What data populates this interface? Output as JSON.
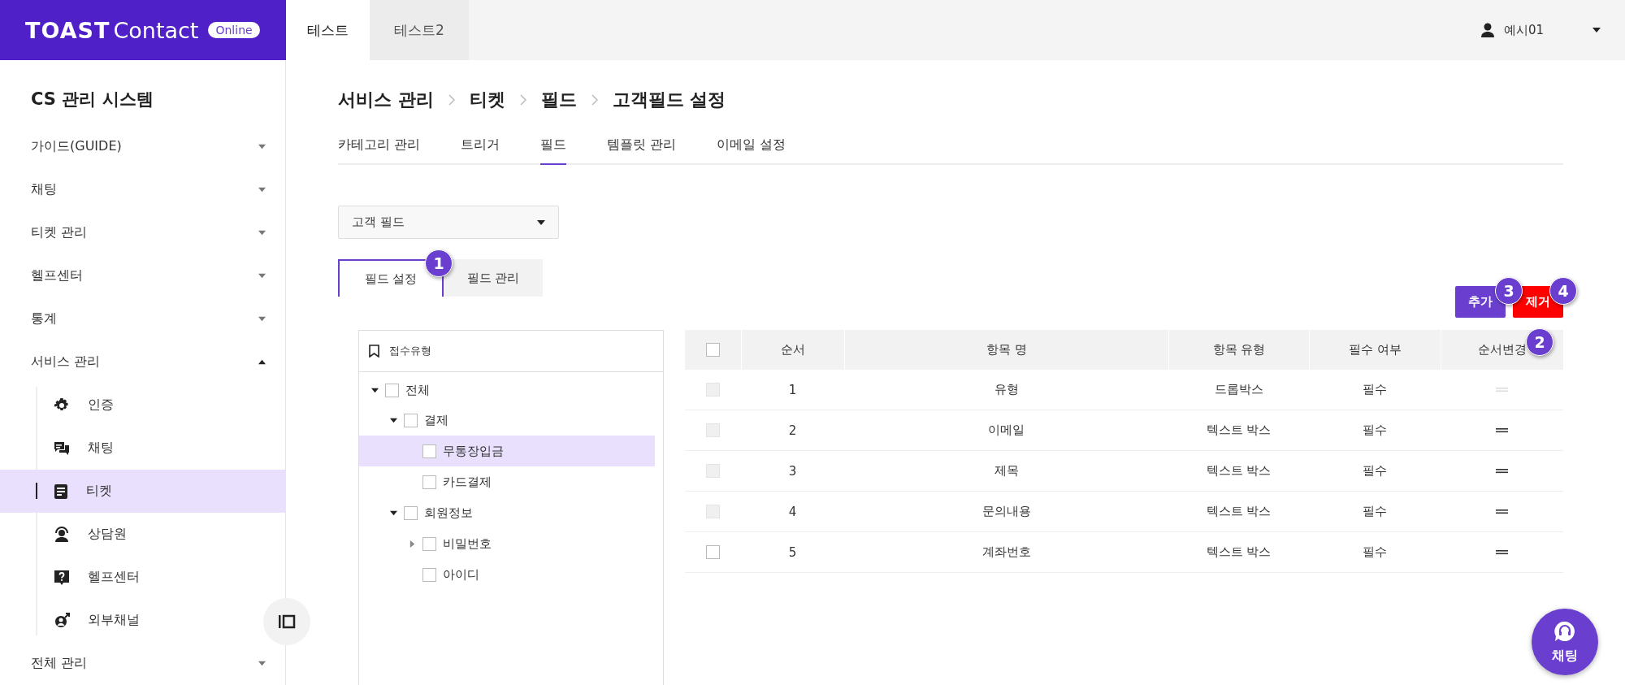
{
  "logo": {
    "brand": "TOAST",
    "product": "Contact",
    "badge": "Online"
  },
  "top_tabs": [
    {
      "label": "테스트",
      "selected": true
    },
    {
      "label": "테스트2",
      "selected": false
    }
  ],
  "user": {
    "name": "예시01"
  },
  "sidebar": {
    "title": "CS 관리 시스템",
    "items": [
      {
        "label": "가이드(GUIDE)",
        "expanded": false
      },
      {
        "label": "채팅",
        "expanded": false
      },
      {
        "label": "티켓 관리",
        "expanded": false
      },
      {
        "label": "헬프센터",
        "expanded": false
      },
      {
        "label": "통계",
        "expanded": false
      },
      {
        "label": "서비스 관리",
        "expanded": true,
        "children": [
          {
            "label": "인증",
            "selected": false
          },
          {
            "label": "채팅",
            "selected": false
          },
          {
            "label": "티켓",
            "selected": true
          },
          {
            "label": "상담원",
            "selected": false
          },
          {
            "label": "헬프센터",
            "selected": false
          },
          {
            "label": "외부채널",
            "selected": false
          }
        ]
      },
      {
        "label": "전체 관리",
        "expanded": false
      }
    ]
  },
  "breadcrumb": [
    "서비스 관리",
    "티켓",
    "필드",
    "고객필드 설정"
  ],
  "tabs": [
    {
      "label": "카테고리 관리",
      "selected": false
    },
    {
      "label": "트리거",
      "selected": false
    },
    {
      "label": "필드",
      "selected": true
    },
    {
      "label": "템플릿 관리",
      "selected": false
    },
    {
      "label": "이메일 설정",
      "selected": false
    }
  ],
  "field_select": {
    "value": "고객 필드"
  },
  "sub_tabs": [
    {
      "label": "필드 설정",
      "selected": true
    },
    {
      "label": "필드 관리",
      "selected": false
    }
  ],
  "tree": {
    "header": "접수유형",
    "nodes": [
      {
        "label": "전체",
        "kind": "group",
        "expanded": true,
        "checked": false,
        "selected": false,
        "children": [
          {
            "label": "결제",
            "kind": "group",
            "expanded": true,
            "checked": false,
            "selected": false,
            "children": [
              {
                "label": "무통장입금",
                "kind": "leaf",
                "checked": false,
                "selected": true
              },
              {
                "label": "카드결제",
                "kind": "leaf",
                "checked": false,
                "selected": false
              }
            ]
          },
          {
            "label": "회원정보",
            "kind": "group",
            "expanded": true,
            "checked": false,
            "selected": false,
            "children": [
              {
                "label": "비밀번호",
                "kind": "group",
                "expanded": false,
                "checked": false,
                "selected": false
              },
              {
                "label": "아이디",
                "kind": "leaf",
                "checked": false,
                "selected": false
              }
            ]
          }
        ]
      }
    ]
  },
  "buttons": [
    {
      "label": "추가",
      "kind": "primary"
    },
    {
      "label": "제거",
      "kind": "danger"
    }
  ],
  "table": {
    "header_checked": false,
    "columns": [
      "순서",
      "항목 명",
      "항목 유형",
      "필수 여부",
      "순서변경"
    ],
    "rows": [
      {
        "checked": false,
        "disabled": true,
        "order": "1",
        "name": "유형",
        "type": "드롭박스",
        "required": "필수"
      },
      {
        "checked": false,
        "disabled": true,
        "order": "2",
        "name": "이메일",
        "type": "텍스트 박스",
        "required": "필수"
      },
      {
        "checked": false,
        "disabled": true,
        "order": "3",
        "name": "제목",
        "type": "텍스트 박스",
        "required": "필수"
      },
      {
        "checked": false,
        "disabled": true,
        "order": "4",
        "name": "문의내용",
        "type": "텍스트 박스",
        "required": "필수"
      },
      {
        "checked": false,
        "disabled": false,
        "order": "5",
        "name": "계좌번호",
        "type": "텍스트 박스",
        "required": "필수"
      }
    ]
  },
  "markers": [
    "1",
    "2",
    "3",
    "4"
  ],
  "chat_button": {
    "label": "채팅"
  }
}
